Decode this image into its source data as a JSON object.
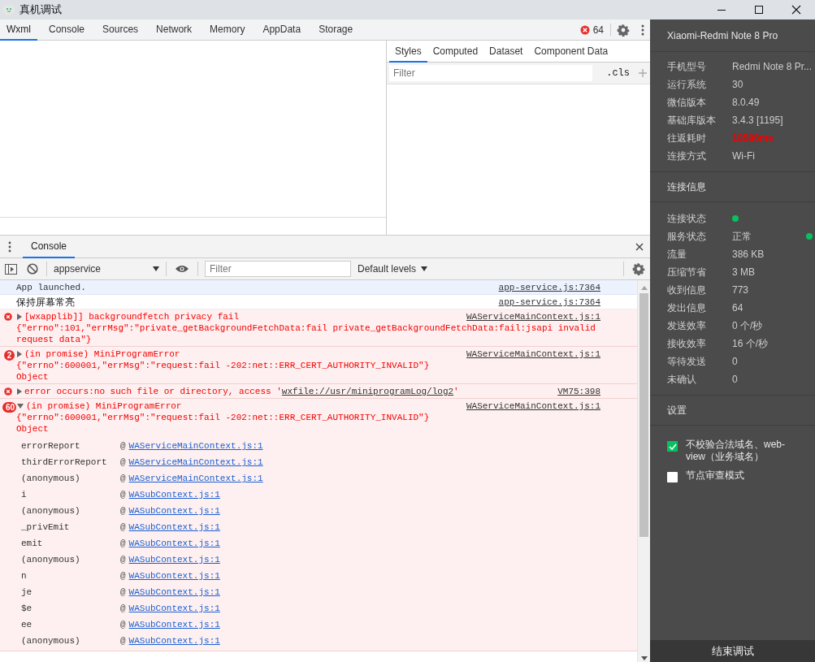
{
  "window": {
    "title": "真机调试"
  },
  "devtools": {
    "tabs": [
      {
        "label": "Wxml",
        "selected": true
      },
      {
        "label": "Console",
        "selected": false
      },
      {
        "label": "Sources",
        "selected": false
      },
      {
        "label": "Network",
        "selected": false
      },
      {
        "label": "Memory",
        "selected": false
      },
      {
        "label": "AppData",
        "selected": false
      },
      {
        "label": "Storage",
        "selected": false
      }
    ],
    "error_count": "64"
  },
  "styles_pane": {
    "tabs": [
      {
        "label": "Styles",
        "selected": true
      },
      {
        "label": "Computed",
        "selected": false
      },
      {
        "label": "Dataset",
        "selected": false
      },
      {
        "label": "Component Data",
        "selected": false
      }
    ],
    "filter": {
      "placeholder": "Filter"
    },
    "cls_button": ".cls"
  },
  "console": {
    "tab": "Console",
    "context": "appservice",
    "filter": {
      "placeholder": "Filter"
    },
    "levels": "Default levels",
    "messages": [
      {
        "kind": "info",
        "parts": [
          "App launched."
        ],
        "source": "app-service.js:7364"
      },
      {
        "kind": "log",
        "parts": [
          "保持屏幕常亮"
        ],
        "source": "app-service.js:7364"
      },
      {
        "kind": "error",
        "expanded": false,
        "parts": [
          "[wxapplib]] backgroundfetch privacy fail"
        ],
        "details": [
          "{\"errno\":101,\"errMsg\":\"private_getBackgroundFetchData:fail private_getBackgroundFetchData:fail:jsapi invalid request data\"}"
        ],
        "source": "WAServiceMainContext.js:1"
      },
      {
        "kind": "error",
        "count": "2",
        "expanded": false,
        "parts": [
          "(in promise) MiniProgramError"
        ],
        "details": [
          "{\"errno\":600001,\"errMsg\":\"request:fail -202:net::ERR_CERT_AUTHORITY_INVALID\"}",
          "Object"
        ],
        "source": "WAServiceMainContext.js:1"
      },
      {
        "kind": "error",
        "expanded": false,
        "parts": [
          "error occurs:no such file or directory, access '",
          "wxfile://usr/miniprogramLog/log2",
          "'"
        ],
        "source": "VM75:398"
      },
      {
        "kind": "error",
        "count": "60",
        "expanded": true,
        "parts": [
          "(in promise) MiniProgramError"
        ],
        "details": [
          "{\"errno\":600001,\"errMsg\":\"request:fail -202:net::ERR_CERT_AUTHORITY_INVALID\"}",
          "Object"
        ],
        "source": "WAServiceMainContext.js:1",
        "stack": [
          {
            "fn": "errorReport",
            "at": "@",
            "link": "WAServiceMainContext.js:1"
          },
          {
            "fn": "thirdErrorReport",
            "at": "@",
            "link": "WAServiceMainContext.js:1"
          },
          {
            "fn": "(anonymous)",
            "at": "@",
            "link": "WAServiceMainContext.js:1"
          },
          {
            "fn": "i",
            "at": "@",
            "link": "WASubContext.js:1"
          },
          {
            "fn": "(anonymous)",
            "at": "@",
            "link": "WASubContext.js:1"
          },
          {
            "fn": "_privEmit",
            "at": "@",
            "link": "WASubContext.js:1"
          },
          {
            "fn": "emit",
            "at": "@",
            "link": "WASubContext.js:1"
          },
          {
            "fn": "(anonymous)",
            "at": "@",
            "link": "WASubContext.js:1"
          },
          {
            "fn": "n",
            "at": "@",
            "link": "WASubContext.js:1"
          },
          {
            "fn": "je",
            "at": "@",
            "link": "WASubContext.js:1"
          },
          {
            "fn": "$e",
            "at": "@",
            "link": "WASubContext.js:1"
          },
          {
            "fn": "ee",
            "at": "@",
            "link": "WASubContext.js:1"
          },
          {
            "fn": "(anonymous)",
            "at": "@",
            "link": "WASubContext.js:1"
          }
        ]
      }
    ]
  },
  "device_panel": {
    "device": "Xiaomi-Redmi Note 8 Pro",
    "info": [
      {
        "label": "手机型号",
        "value": "Redmi Note 8 Pr...",
        "kind": "text"
      },
      {
        "label": "运行系统",
        "value": "30",
        "kind": "text"
      },
      {
        "label": "微信版本",
        "value": "8.0.49",
        "kind": "text"
      },
      {
        "label": "基础库版本",
        "value": "3.4.3 [1195]",
        "kind": "text"
      },
      {
        "label": "往返耗时",
        "value": "18586ms",
        "kind": "alert"
      },
      {
        "label": "连接方式",
        "value": "Wi-Fi",
        "kind": "text"
      }
    ],
    "connection_title": "连接信息",
    "connection": [
      {
        "label": "连接状态",
        "kind": "dot",
        "color": "#07c160"
      },
      {
        "label": "服务状态",
        "value": "正常",
        "kind": "text_dot",
        "color": "#07c160"
      },
      {
        "label": "流量",
        "value": "386 KB",
        "kind": "text"
      },
      {
        "label": "压缩节省",
        "value": "3 MB",
        "kind": "text"
      },
      {
        "label": "收到信息",
        "value": "773",
        "kind": "text"
      },
      {
        "label": "发出信息",
        "value": "64",
        "kind": "text"
      },
      {
        "label": "发送效率",
        "value": "0 个/秒",
        "kind": "text"
      },
      {
        "label": "接收效率",
        "value": "16 个/秒",
        "kind": "text"
      },
      {
        "label": "等待发送",
        "value": "0",
        "kind": "text"
      },
      {
        "label": "未确认",
        "value": "0",
        "kind": "text"
      }
    ],
    "settings_title": "设置",
    "settings": [
      {
        "label": "不校验合法域名、web-view（业务域名）",
        "checked": true
      },
      {
        "label": "节点审查模式",
        "checked": false
      }
    ],
    "end_button": "结束调试"
  }
}
